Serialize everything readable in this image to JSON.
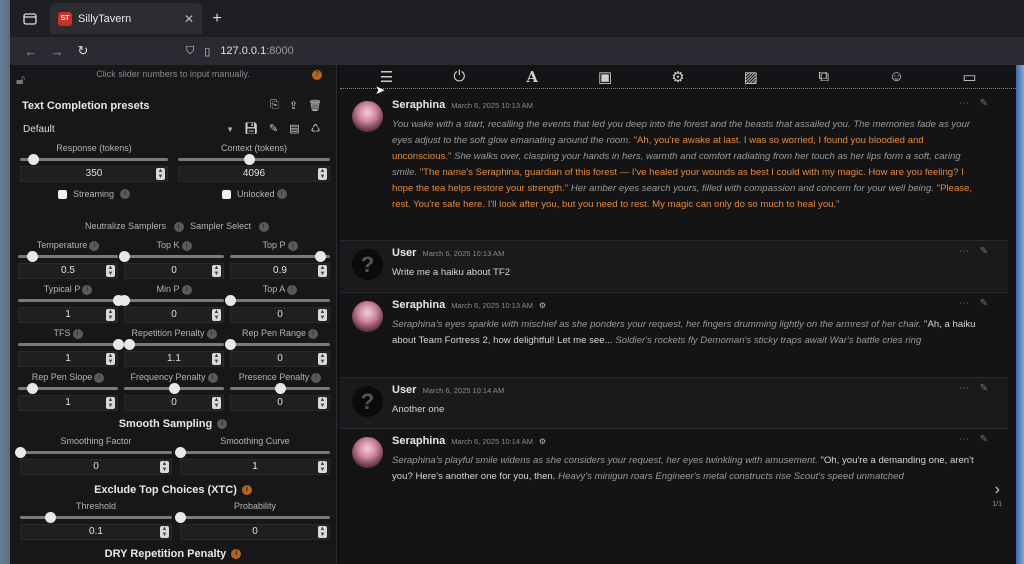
{
  "browser": {
    "tab_title": "SillyTavern",
    "favicon_text": "ST",
    "url_host": "127.0.0.1",
    "url_port": ":8000"
  },
  "left": {
    "hint": "Click slider numbers to input manually.",
    "presets_title": "Text Completion presets",
    "preset_selected": "Default",
    "response": {
      "label": "Response (tokens)",
      "value": "350",
      "position": 0.09
    },
    "context": {
      "label": "Context (tokens)",
      "value": "4096",
      "position": 0.47
    },
    "streaming_label": "Streaming",
    "unlocked_label": "Unlocked",
    "neutralize_label": "Neutralize Samplers",
    "sampler_select_label": "Sampler Select",
    "sliders": [
      {
        "label": "Temperature",
        "value": "0.5",
        "position": 0.14
      },
      {
        "label": "Top K",
        "value": "0",
        "position": 0.0
      },
      {
        "label": "Top P",
        "value": "0.9",
        "position": 0.9
      },
      {
        "label": "Typical P",
        "value": "1",
        "position": 1.0
      },
      {
        "label": "Min P",
        "value": "0",
        "position": 0.0
      },
      {
        "label": "Top A",
        "value": "0",
        "position": 0.0
      },
      {
        "label": "TFS",
        "value": "1",
        "position": 1.0
      },
      {
        "label": "Repetition Penalty",
        "value": "1.1",
        "position": 0.05
      },
      {
        "label": "Rep Pen Range",
        "value": "0",
        "position": 0.0
      },
      {
        "label": "Rep Pen Slope",
        "value": "1",
        "position": 0.14
      },
      {
        "label": "Frequency Penalty",
        "value": "0",
        "position": 0.5
      },
      {
        "label": "Presence Penalty",
        "value": "0",
        "position": 0.5
      }
    ],
    "smooth_title": "Smooth Sampling",
    "smooth_factor": {
      "label": "Smoothing Factor",
      "value": "0",
      "position": 0.0
    },
    "smooth_curve": {
      "label": "Smoothing Curve",
      "value": "1",
      "position": 0.0
    },
    "xtc_title": "Exclude Top Choices (XTC)",
    "xtc_threshold": {
      "label": "Threshold",
      "value": "0.1",
      "position": 0.2
    },
    "xtc_probability": {
      "label": "Probability",
      "value": "0",
      "position": 0.0
    },
    "dry_title": "DRY Repetition Penalty"
  },
  "chat": {
    "messages": [
      {
        "name": "Seraphina",
        "time": "March 6, 2025 10:13 AM",
        "segments": [
          {
            "t": "You wake with a start, recalling the events that led you deep into the forest and the beasts that assailed you. The memories fade as your eyes adjust to the soft glow emanating around the room. ",
            "s": "it"
          },
          {
            "t": "\"Ah, you're awake at last. I was so worried, I found you bloodied and unconscious.\"",
            "s": "qt"
          },
          {
            "t": " She walks over, clasping your hands in hers, warmth and comfort radiating from her touch as her lips form a soft, caring smile. ",
            "s": "it"
          },
          {
            "t": "\"The name's Seraphina, guardian of this forest — I've healed your wounds as best I could with my magic. How are you feeling? I hope the tea helps restore your strength.\"",
            "s": "qt"
          },
          {
            "t": " Her amber eyes search yours, filled with compassion and concern for your well being. ",
            "s": "it"
          },
          {
            "t": "\"Please, rest. You're safe here. I'll look after you, but you need to rest. My magic can only do so much to heal you.\"",
            "s": "qt"
          }
        ]
      },
      {
        "name": "User",
        "time": "March 6, 2025 10:13 AM",
        "segments": [
          {
            "t": "Write me a haiku about TF2",
            "s": ""
          }
        ]
      },
      {
        "name": "Seraphina",
        "time": "March 6, 2025 10:13 AM",
        "segments": [
          {
            "t": "Seraphina's eyes sparkle with mischief as she ponders your request, her fingers drumming lightly on the armrest of her chair. ",
            "s": "it"
          },
          {
            "t": "\"Ah, a haiku about Team Fortress 2, how delightful! Let me see... ",
            "s": ""
          },
          {
            "t": "Soldier's rockets fly Demoman's sticky traps await War's battle cries ring",
            "s": "it"
          }
        ]
      },
      {
        "name": "User",
        "time": "March 6, 2025 10:14 AM",
        "segments": [
          {
            "t": "Another one",
            "s": ""
          }
        ]
      },
      {
        "name": "Seraphina",
        "time": "March 6, 2025 10:14 AM",
        "segments": [
          {
            "t": "Seraphina's playful smile widens as she considers your request, her eyes twinkling with amusement. ",
            "s": "it"
          },
          {
            "t": "\"Oh, you're a demanding one, aren't you? Here's another one for you, then. ",
            "s": ""
          },
          {
            "t": "Heavy's minigun roars Engineer's metal constructs rise Scout's speed unmatched",
            "s": "it"
          }
        ]
      }
    ],
    "pager": "1/1"
  }
}
